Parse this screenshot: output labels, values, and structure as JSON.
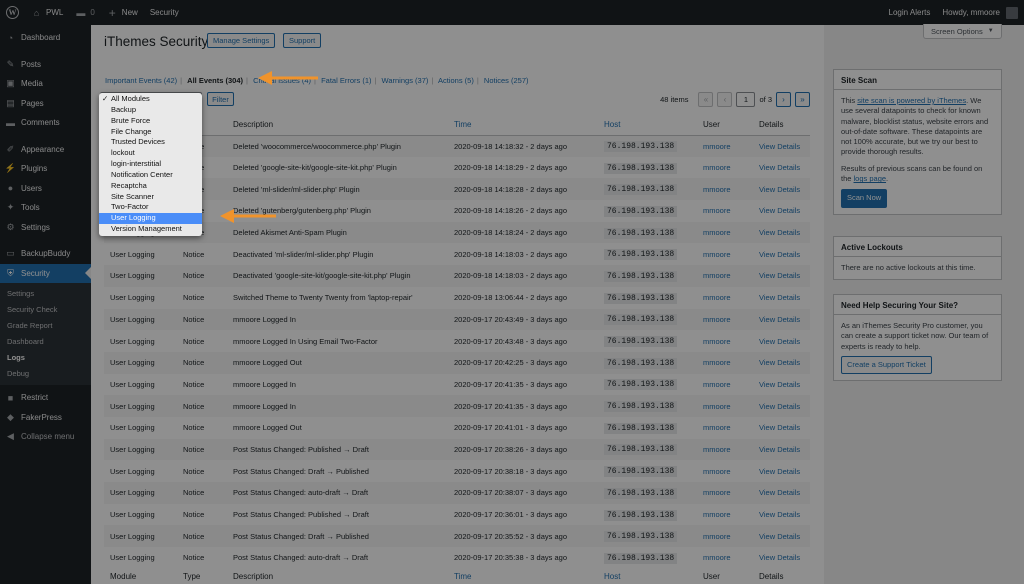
{
  "adminbar": {
    "site": "PWL",
    "comments": "0",
    "new_label": "New",
    "security_label": "Security",
    "login_alerts": "Login Alerts",
    "howdy": "Howdy, mmoore"
  },
  "sidebar": {
    "items": [
      {
        "label": "Dashboard",
        "icon": "gauge-icon"
      },
      {
        "label": "Posts",
        "icon": "pin-icon"
      },
      {
        "label": "Media",
        "icon": "media-icon"
      },
      {
        "label": "Pages",
        "icon": "page-icon"
      },
      {
        "label": "Comments",
        "icon": "comment-icon"
      },
      {
        "label": "Appearance",
        "icon": "brush-icon"
      },
      {
        "label": "Plugins",
        "icon": "plug-icon"
      },
      {
        "label": "Users",
        "icon": "user-icon"
      },
      {
        "label": "Tools",
        "icon": "wrench-icon"
      },
      {
        "label": "Settings",
        "icon": "settings-icon"
      },
      {
        "label": "BackupBuddy",
        "icon": "backup-icon"
      },
      {
        "label": "Security",
        "icon": "shield-icon"
      }
    ],
    "submenu": [
      "Settings",
      "Security Check",
      "Grade Report",
      "Dashboard",
      "Logs",
      "Debug"
    ],
    "after": [
      {
        "label": "Restrict",
        "icon": "lock-icon"
      },
      {
        "label": "FakerPress",
        "icon": "faker-icon"
      },
      {
        "label": "Collapse menu",
        "icon": "collapse-icon"
      }
    ]
  },
  "header": {
    "title": "iThemes Security",
    "manage_settings": "Manage Settings",
    "support": "Support",
    "screen_options": "Screen Options"
  },
  "filters": [
    {
      "label": "Important Events (42)",
      "current": false
    },
    {
      "label": "All Events (304)",
      "current": true
    },
    {
      "label": "Critical Issues (4)",
      "current": false
    },
    {
      "label": "Fatal Errors (1)",
      "current": false
    },
    {
      "label": "Warnings (37)",
      "current": false
    },
    {
      "label": "Actions (5)",
      "current": false
    },
    {
      "label": "Notices (257)",
      "current": false
    }
  ],
  "filter_button": "Filter",
  "pagination": {
    "items": "48 items",
    "first": "«",
    "prev": "‹",
    "current_page": "1",
    "of_pages": "of 3",
    "next": "›",
    "last": "»"
  },
  "dropdown": {
    "options": [
      "All Modules",
      "Backup",
      "Brute Force",
      "File Change",
      "Trusted Devices",
      "lockout",
      "login-interstitial",
      "Notification Center",
      "Recaptcha",
      "Site Scanner",
      "Two-Factor",
      "User Logging",
      "Version Management"
    ],
    "checked": "All Modules",
    "highlighted": "User Logging"
  },
  "table": {
    "columns": [
      "Module",
      "Type",
      "Description",
      "Time",
      "Host",
      "User",
      "Details"
    ],
    "rows": [
      [
        "User Logging",
        "Notice",
        "Deleted 'woocommerce/woocommerce.php' Plugin",
        "2020-09-18 14:18:32 - 2 days ago",
        "76.198.193.138",
        "mmoore",
        "View Details"
      ],
      [
        "User Logging",
        "Notice",
        "Deleted 'google-site-kit/google-site-kit.php' Plugin",
        "2020-09-18 14:18:29 - 2 days ago",
        "76.198.193.138",
        "mmoore",
        "View Details"
      ],
      [
        "User Logging",
        "Notice",
        "Deleted 'ml-slider/ml-slider.php' Plugin",
        "2020-09-18 14:18:28 - 2 days ago",
        "76.198.193.138",
        "mmoore",
        "View Details"
      ],
      [
        "User Logging",
        "Notice",
        "Deleted 'gutenberg/gutenberg.php' Plugin",
        "2020-09-18 14:18:26 - 2 days ago",
        "76.198.193.138",
        "mmoore",
        "View Details"
      ],
      [
        "User Logging",
        "Notice",
        "Deleted Akismet Anti-Spam Plugin",
        "2020-09-18 14:18:24 - 2 days ago",
        "76.198.193.138",
        "mmoore",
        "View Details"
      ],
      [
        "User Logging",
        "Notice",
        "Deactivated 'ml-slider/ml-slider.php' Plugin",
        "2020-09-18 14:18:03 - 2 days ago",
        "76.198.193.138",
        "mmoore",
        "View Details"
      ],
      [
        "User Logging",
        "Notice",
        "Deactivated 'google-site-kit/google-site-kit.php' Plugin",
        "2020-09-18 14:18:03 - 2 days ago",
        "76.198.193.138",
        "mmoore",
        "View Details"
      ],
      [
        "User Logging",
        "Notice",
        "Switched Theme to Twenty Twenty from 'laptop-repair'",
        "2020-09-18 13:06:44 - 2 days ago",
        "76.198.193.138",
        "mmoore",
        "View Details"
      ],
      [
        "User Logging",
        "Notice",
        "mmoore Logged In",
        "2020-09-17 20:43:49 - 3 days ago",
        "76.198.193.138",
        "mmoore",
        "View Details"
      ],
      [
        "User Logging",
        "Notice",
        "mmoore Logged In Using Email Two-Factor",
        "2020-09-17 20:43:48 - 3 days ago",
        "76.198.193.138",
        "mmoore",
        "View Details"
      ],
      [
        "User Logging",
        "Notice",
        "mmoore Logged Out",
        "2020-09-17 20:42:25 - 3 days ago",
        "76.198.193.138",
        "mmoore",
        "View Details"
      ],
      [
        "User Logging",
        "Notice",
        "mmoore Logged In",
        "2020-09-17 20:41:35 - 3 days ago",
        "76.198.193.138",
        "mmoore",
        "View Details"
      ],
      [
        "User Logging",
        "Notice",
        "mmoore Logged In",
        "2020-09-17 20:41:35 - 3 days ago",
        "76.198.193.138",
        "mmoore",
        "View Details"
      ],
      [
        "User Logging",
        "Notice",
        "mmoore Logged Out",
        "2020-09-17 20:41:01 - 3 days ago",
        "76.198.193.138",
        "mmoore",
        "View Details"
      ],
      [
        "User Logging",
        "Notice",
        "Post Status Changed: Published → Draft",
        "2020-09-17 20:38:26 - 3 days ago",
        "76.198.193.138",
        "mmoore",
        "View Details"
      ],
      [
        "User Logging",
        "Notice",
        "Post Status Changed: Draft → Published",
        "2020-09-17 20:38:18 - 3 days ago",
        "76.198.193.138",
        "mmoore",
        "View Details"
      ],
      [
        "User Logging",
        "Notice",
        "Post Status Changed: auto-draft → Draft",
        "2020-09-17 20:38:07 - 3 days ago",
        "76.198.193.138",
        "mmoore",
        "View Details"
      ],
      [
        "User Logging",
        "Notice",
        "Post Status Changed: Published → Draft",
        "2020-09-17 20:36:01 - 3 days ago",
        "76.198.193.138",
        "mmoore",
        "View Details"
      ],
      [
        "User Logging",
        "Notice",
        "Post Status Changed: Draft → Published",
        "2020-09-17 20:35:52 - 3 days ago",
        "76.198.193.138",
        "mmoore",
        "View Details"
      ],
      [
        "User Logging",
        "Notice",
        "Post Status Changed: auto-draft → Draft",
        "2020-09-17 20:35:38 - 3 days ago",
        "76.198.193.138",
        "mmoore",
        "View Details"
      ]
    ]
  },
  "widgets": {
    "site_scan": {
      "title": "Site Scan",
      "text_before": "This ",
      "link": "site scan is powered by iThemes",
      "text_after": ". We use several datapoints to check for known malware, blocklist status, website errors and out-of-date software. These datapoints are not 100% accurate, but we try our best to provide thorough results.",
      "results_before": "Results of previous scans can be found on the ",
      "results_link": "logs page",
      "results_after": ".",
      "button": "Scan Now"
    },
    "lockouts": {
      "title": "Active Lockouts",
      "text": "There are no active lockouts at this time."
    },
    "help": {
      "title": "Need Help Securing Your Site?",
      "text": "As an iThemes Security Pro customer, you can create a support ticket now. Our team of experts is ready to help.",
      "button": "Create a Support Ticket"
    }
  },
  "colors": {
    "accent": "#2271b1",
    "sidebar_bg": "#1d2327",
    "highlight": "#4a8df8",
    "annotation_arrow": "#f0932b"
  }
}
